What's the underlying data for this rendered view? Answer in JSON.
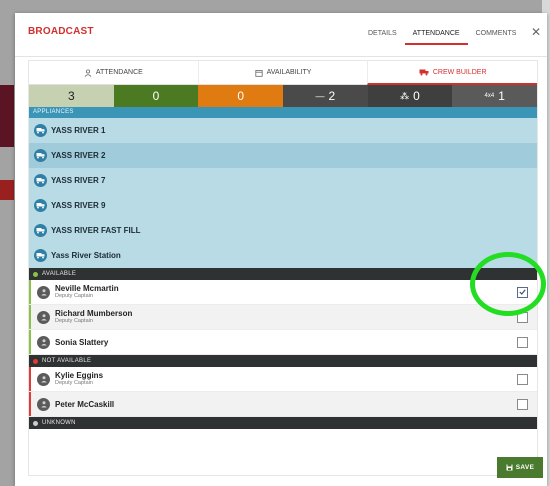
{
  "modal": {
    "title": "BROADCAST",
    "tabs": [
      "DETAILS",
      "ATTENDANCE",
      "COMMENTS"
    ],
    "active_tab": "ATTENDANCE",
    "close_label": "✕"
  },
  "sub_tabs": [
    {
      "label": "ATTENDANCE",
      "icon": "person-icon"
    },
    {
      "label": "AVAILABILITY",
      "icon": "calendar-icon"
    },
    {
      "label": "CREW BUILDER",
      "icon": "truck-icon"
    }
  ],
  "stats": [
    {
      "value": "3",
      "icon": "",
      "color": "#c5d1b0",
      "text_color": "#222222"
    },
    {
      "value": "0",
      "icon": "",
      "color": "#4b7a22",
      "text_color": "#ffffff"
    },
    {
      "value": "0",
      "icon": "",
      "color": "#e07b12",
      "text_color": "#ffffff"
    },
    {
      "value": "2",
      "icon": "—",
      "color": "#4a4a4a",
      "text_color": "#ffffff"
    },
    {
      "value": "0",
      "icon": "⁂",
      "color": "#3f3f3f",
      "text_color": "#ffffff"
    },
    {
      "value": "1",
      "icon": "4x4",
      "color": "#5a5a5a",
      "text_color": "#ffffff"
    }
  ],
  "appliances": {
    "header": "APPLIANCES",
    "items": [
      "YASS RIVER 1",
      "YASS RIVER 2",
      "YASS RIVER 7",
      "YASS RIVER 9",
      "YASS RIVER FAST FILL",
      "Yass River Station"
    ]
  },
  "groups": {
    "available": {
      "label": "AVAILABLE",
      "color": "#8bc34a",
      "people": [
        {
          "name": "Neville Mcmartin",
          "role": "Deputy Captain",
          "checked": true
        },
        {
          "name": "Richard Mumberson",
          "role": "Deputy Captain",
          "checked": false
        },
        {
          "name": "Sonia Slattery",
          "role": "",
          "checked": false
        }
      ]
    },
    "not_available": {
      "label": "NOT AVAILABLE",
      "color": "#e53935",
      "people": [
        {
          "name": "Kylie Eggins",
          "role": "Deputy Captain",
          "checked": false
        },
        {
          "name": "Peter McCaskill",
          "role": "",
          "checked": false
        }
      ]
    },
    "unknown": {
      "label": "UNKNOWN",
      "color": "#cccccc"
    }
  },
  "save_label": "SAVE",
  "colors": {
    "brand_red": "#d32f2f",
    "save_green": "#4a7a2e",
    "annotation": "#22dd22"
  }
}
